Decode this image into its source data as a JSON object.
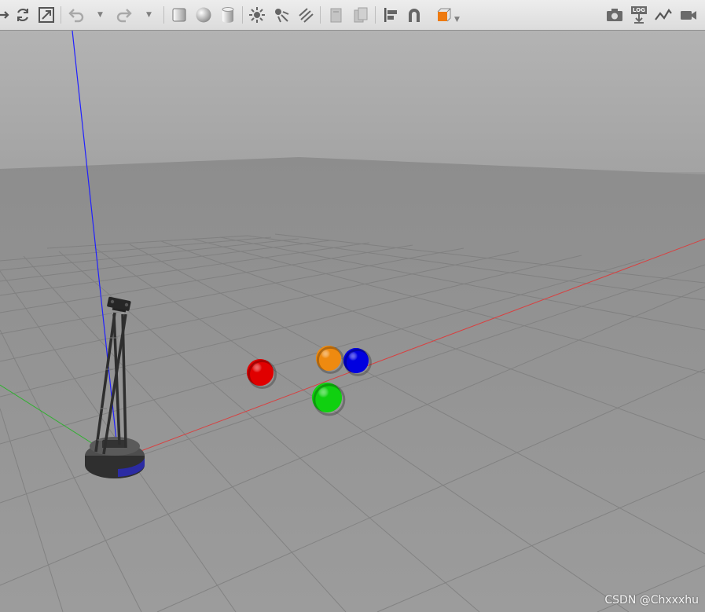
{
  "toolbar": {
    "tools": [
      {
        "name": "translate-mode-button",
        "icon": "translate-icon"
      },
      {
        "name": "rotate-mode-button",
        "icon": "rotate-icon"
      },
      {
        "name": "scale-mode-button",
        "icon": "scale-icon"
      },
      {
        "name": "undo-button",
        "icon": "undo-icon"
      },
      {
        "name": "redo-button",
        "icon": "redo-icon"
      },
      {
        "name": "insert-box-button",
        "icon": "box-icon"
      },
      {
        "name": "insert-sphere-button",
        "icon": "sphere-icon"
      },
      {
        "name": "insert-cylinder-button",
        "icon": "cylinder-icon"
      },
      {
        "name": "point-light-button",
        "icon": "point-light-icon"
      },
      {
        "name": "spot-light-button",
        "icon": "spot-light-icon"
      },
      {
        "name": "directional-light-button",
        "icon": "directional-light-icon"
      },
      {
        "name": "copy-button",
        "icon": "copy-icon"
      },
      {
        "name": "paste-button",
        "icon": "paste-icon"
      },
      {
        "name": "align-button",
        "icon": "align-icon"
      },
      {
        "name": "snap-button",
        "icon": "magnet-icon"
      },
      {
        "name": "view-angle-button",
        "icon": "view-cube-icon"
      },
      {
        "name": "screenshot-button",
        "icon": "camera-icon"
      },
      {
        "name": "log-button",
        "icon": "log-icon"
      },
      {
        "name": "plot-button",
        "icon": "plot-icon"
      },
      {
        "name": "record-video-button",
        "icon": "video-icon"
      }
    ],
    "log_label": "LOG"
  },
  "scene": {
    "spheres": [
      {
        "name": "red-sphere",
        "color": "#e00000"
      },
      {
        "name": "orange-sphere",
        "color": "#ee8a10"
      },
      {
        "name": "blue-sphere",
        "color": "#0000e0"
      },
      {
        "name": "green-sphere",
        "color": "#10d010"
      }
    ],
    "axis_colors": {
      "x": "#e03030",
      "y": "#30b030",
      "z": "#2020ff"
    }
  },
  "watermark": "CSDN @Chxxxhu"
}
